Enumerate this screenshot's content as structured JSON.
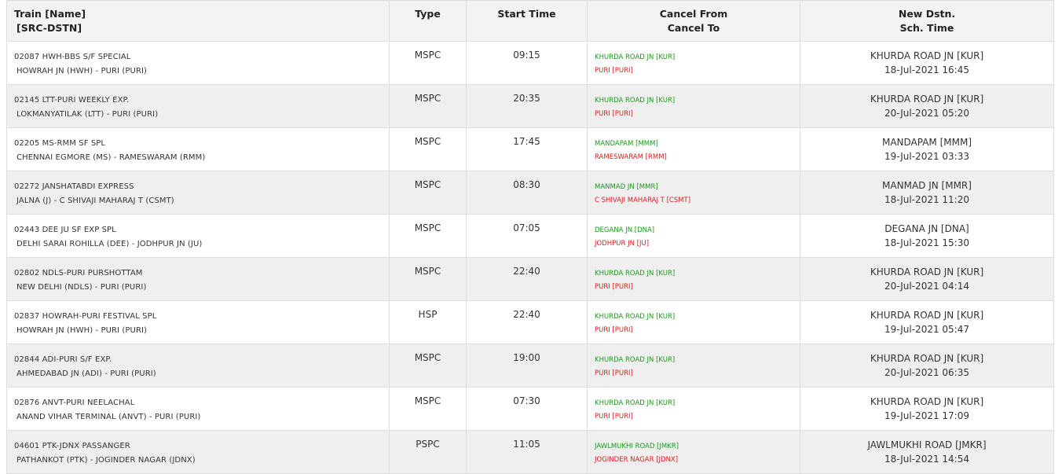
{
  "header": {
    "train_line1": "Train [Name]",
    "train_line2": "[SRC-DSTN]",
    "type": "Type",
    "start_time": "Start Time",
    "cancel_line1": "Cancel From",
    "cancel_line2": "Cancel To",
    "new_line1": "New Dstn.",
    "new_line2": "Sch. Time"
  },
  "rows": [
    {
      "name": "02087 HWH-BBS S/F SPECIAL",
      "route": "HOWRAH JN (HWH) - PURI (PURI)",
      "type": "MSPC",
      "start": "09:15",
      "cancel_from": "KHURDA ROAD JN [KUR]",
      "cancel_to": "PURI [PURI]",
      "new_dstn": "KHURDA ROAD JN [KUR]",
      "sch_time": "18-Jul-2021 16:45"
    },
    {
      "name": "02145 LTT-PURI WEEKLY EXP.",
      "route": "LOKMANYATILAK (LTT) - PURI (PURI)",
      "type": "MSPC",
      "start": "20:35",
      "cancel_from": "KHURDA ROAD JN [KUR]",
      "cancel_to": "PURI [PURI]",
      "new_dstn": "KHURDA ROAD JN [KUR]",
      "sch_time": "20-Jul-2021 05:20"
    },
    {
      "name": "02205 MS-RMM SF SPL",
      "route": "CHENNAI EGMORE (MS) - RAMESWARAM (RMM)",
      "type": "MSPC",
      "start": "17:45",
      "cancel_from": "MANDAPAM [MMM]",
      "cancel_to": "RAMESWARAM [RMM]",
      "new_dstn": "MANDAPAM [MMM]",
      "sch_time": "19-Jul-2021 03:33"
    },
    {
      "name": "02272 JANSHATABDI EXPRESS",
      "route": "JALNA (J) - C SHIVAJI MAHARAJ T (CSMT)",
      "type": "MSPC",
      "start": "08:30",
      "cancel_from": "MANMAD JN [MMR]",
      "cancel_to": "C SHIVAJI MAHARAJ T [CSMT]",
      "new_dstn": "MANMAD JN [MMR]",
      "sch_time": "18-Jul-2021 11:20"
    },
    {
      "name": "02443 DEE JU SF EXP SPL",
      "route": "DELHI SARAI ROHILLA (DEE) - JODHPUR JN (JU)",
      "type": "MSPC",
      "start": "07:05",
      "cancel_from": "DEGANA JN [DNA]",
      "cancel_to": "JODHPUR JN [JU]",
      "new_dstn": "DEGANA JN [DNA]",
      "sch_time": "18-Jul-2021 15:30"
    },
    {
      "name": "02802 NDLS-PURI PURSHOTTAM",
      "route": "NEW DELHI (NDLS) - PURI (PURI)",
      "type": "MSPC",
      "start": "22:40",
      "cancel_from": "KHURDA ROAD JN [KUR]",
      "cancel_to": "PURI [PURI]",
      "new_dstn": "KHURDA ROAD JN [KUR]",
      "sch_time": "20-Jul-2021 04:14"
    },
    {
      "name": "02837 HOWRAH-PURI FESTIVAL SPL",
      "route": "HOWRAH JN (HWH) - PURI (PURI)",
      "type": "HSP",
      "start": "22:40",
      "cancel_from": "KHURDA ROAD JN [KUR]",
      "cancel_to": "PURI [PURI]",
      "new_dstn": "KHURDA ROAD JN [KUR]",
      "sch_time": "19-Jul-2021 05:47"
    },
    {
      "name": "02844 ADI-PURI S/F EXP.",
      "route": "AHMEDABAD JN (ADI) - PURI (PURI)",
      "type": "MSPC",
      "start": "19:00",
      "cancel_from": "KHURDA ROAD JN [KUR]",
      "cancel_to": "PURI [PURI]",
      "new_dstn": "KHURDA ROAD JN [KUR]",
      "sch_time": "20-Jul-2021 06:35"
    },
    {
      "name": "02876 ANVT-PURI NEELACHAL",
      "route": "ANAND VIHAR TERMINAL (ANVT) - PURI (PURI)",
      "type": "MSPC",
      "start": "07:30",
      "cancel_from": "KHURDA ROAD JN [KUR]",
      "cancel_to": "PURI [PURI]",
      "new_dstn": "KHURDA ROAD JN [KUR]",
      "sch_time": "19-Jul-2021 17:09"
    },
    {
      "name": "04601 PTK-JDNX PASSANGER",
      "route": "PATHANKOT (PTK) - JOGINDER NAGAR (JDNX)",
      "type": "PSPC",
      "start": "11:05",
      "cancel_from": "JAWLMUKHI ROAD [JMKR]",
      "cancel_to": "JOGINDER NAGAR [JDNX]",
      "new_dstn": "JAWLMUKHI ROAD [JMKR]",
      "sch_time": "18-Jul-2021 14:54"
    }
  ],
  "colors": {
    "cancel_from": "#1a9a1a",
    "cancel_to": "#e01b1b",
    "row_alt": "#efefef",
    "border": "#dddddd"
  }
}
